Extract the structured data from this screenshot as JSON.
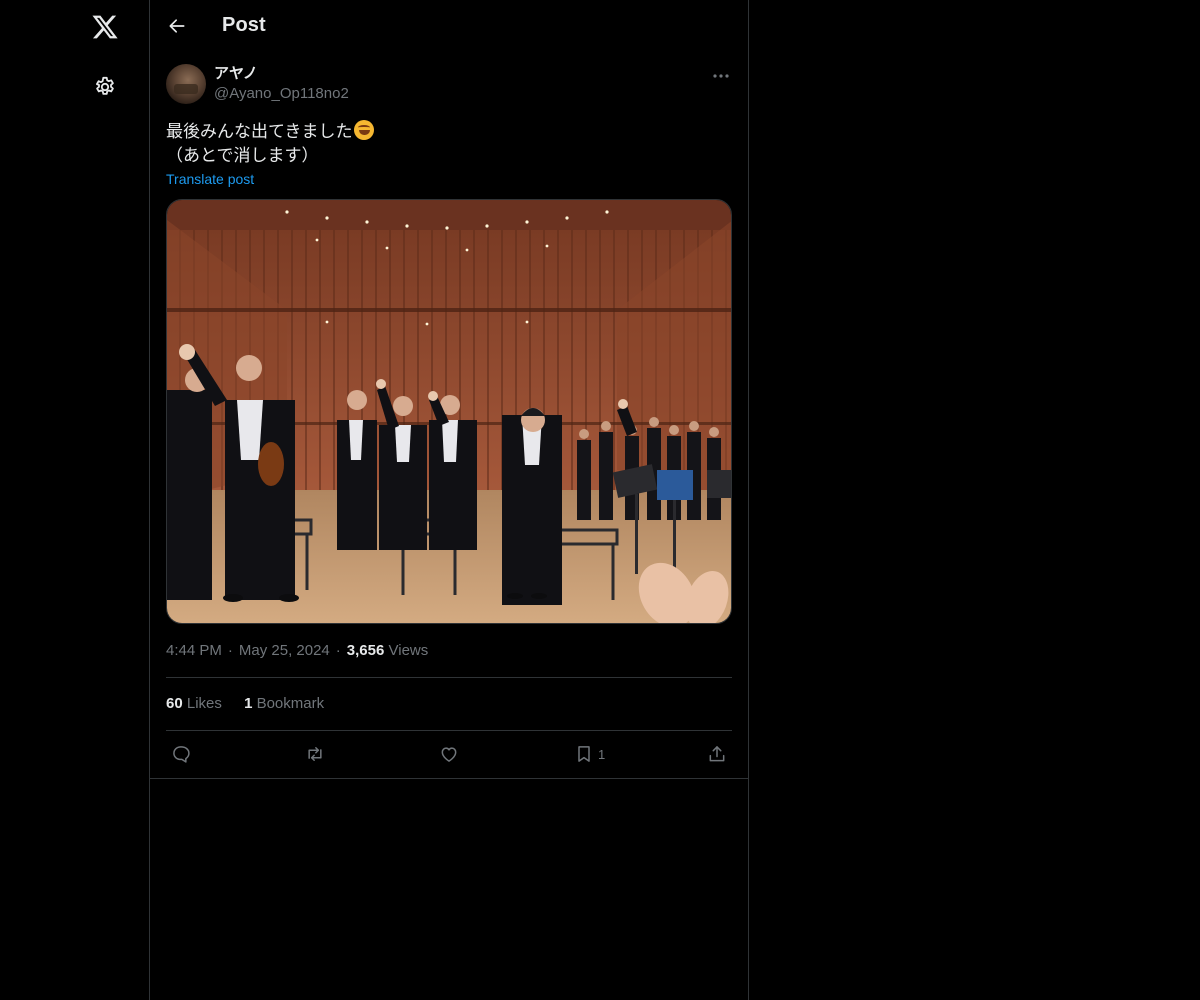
{
  "nav": {
    "logo_icon": "x-logo-icon",
    "settings_icon": "gear-icon"
  },
  "header": {
    "back_icon": "arrow-left-icon",
    "title": "Post"
  },
  "post": {
    "author": {
      "display_name": "アヤノ",
      "handle": "@Ayano_Op118no2"
    },
    "text_line1": "最後みんな出てきました",
    "emoji": "rolling-on-the-floor-laughing-emoji",
    "text_line2": "（あとで消します）",
    "translate_label": "Translate post",
    "media_description": "orchestra-on-stage-photo",
    "time": "4:44 PM",
    "date": "May 25, 2024",
    "views_count": "3,656",
    "views_label": "Views",
    "likes_count": "60",
    "likes_label": "Likes",
    "bookmarks_count": "1",
    "bookmarks_label": "Bookmark",
    "bookmark_action_count": "1"
  },
  "colors": {
    "background": "#000000",
    "text": "#e7e9ea",
    "muted": "#71767b",
    "border": "#2f3336",
    "link": "#1d9bf0"
  }
}
